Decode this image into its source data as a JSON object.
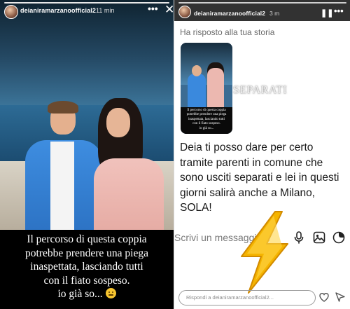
{
  "story": {
    "username": "deianiramarzanoofficial2",
    "time": "11 min",
    "more_icon": "more-horizontal-icon",
    "close_icon": "close-icon",
    "caption_lines": [
      "Il percorso di questa coppia",
      "potrebbe prendere una piega",
      "inaspettata, lasciando tutti",
      "con il fiato sospeso.",
      "io già so..."
    ],
    "caption_emoji": "grimacing-face-emoji"
  },
  "dm": {
    "username": "deianiramarzanoofficial2",
    "time": "3 m",
    "pause_icon": "pause-icon",
    "more_icon": "more-horizontal-icon",
    "replied_label": "Ha risposto alla tua storia",
    "thumbnail_caption_lines": [
      "Il percorso di questa coppia",
      "potrebbe prendere una piega",
      "inaspettata, lasciando tutti",
      "con il fiato sospeso.",
      "io già so... "
    ],
    "overlay_text": "SEPARATI",
    "message_lines": [
      "Deia ti posso dare per certo",
      "tramite parenti in comune che",
      "sono usciti separati e lei in questi",
      "giorni salirà anche a Milano,",
      "SOLA!"
    ],
    "input_placeholder": "Scrivi un messaggio...",
    "reply_placeholder": "Rispondi a deianiramarzanoofficial2...",
    "bolt_color": "#f5b400"
  }
}
